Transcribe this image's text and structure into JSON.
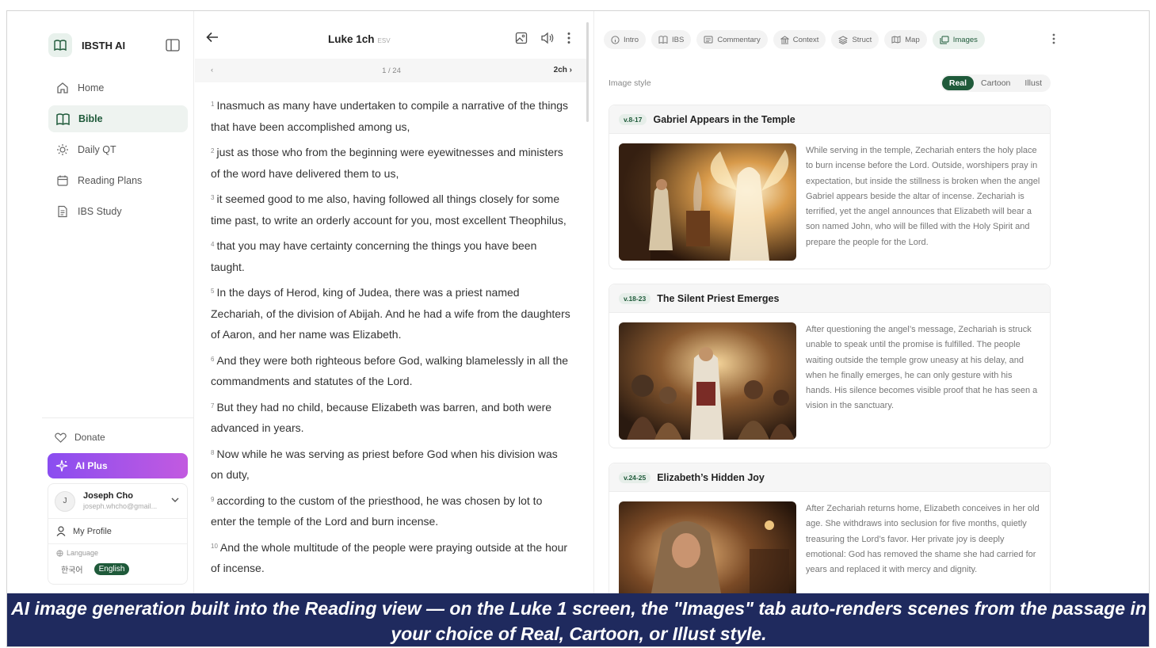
{
  "brand": {
    "name": "IBSTH AI"
  },
  "sidebar": {
    "items": [
      {
        "label": "Home",
        "icon": "home-icon"
      },
      {
        "label": "Bible",
        "icon": "book-icon",
        "active": true
      },
      {
        "label": "Daily QT",
        "icon": "sun-icon"
      },
      {
        "label": "Reading Plans",
        "icon": "calendar-icon"
      },
      {
        "label": "IBS Study",
        "icon": "document-icon"
      }
    ],
    "donate": "Donate",
    "ai_plus": "AI Plus",
    "user": {
      "initial": "J",
      "name": "Joseph Cho",
      "email": "joseph.whcho@gmail..."
    },
    "my_profile": "My Profile",
    "language_label": "Language",
    "languages": [
      "한국어",
      "English"
    ],
    "selected_language": "English"
  },
  "reader": {
    "title": "Luke 1ch",
    "version": "ESV",
    "pager": {
      "prev": "‹",
      "count": "1 / 24",
      "next": "2ch ›"
    },
    "verses": [
      {
        "n": "1",
        "text": "Inasmuch as many have undertaken to compile a narrative of the things that have been accomplished among us,"
      },
      {
        "n": "2",
        "text": "just as those who from the beginning were eyewitnesses and ministers of the word have delivered them to us,"
      },
      {
        "n": "3",
        "text": "it seemed good to me also, having followed all things closely for some time past, to write an orderly account for you, most excellent Theophilus,"
      },
      {
        "n": "4",
        "text": "that you may have certainty concerning the things you have been taught."
      },
      {
        "n": "5",
        "text": "In the days of Herod, king of Judea, there was a priest named Zechariah, of the division of Abijah. And he had a wife from the daughters of Aaron, and her name was Elizabeth."
      },
      {
        "n": "6",
        "text": "And they were both righteous before God, walking blamelessly in all the commandments and statutes of the Lord."
      },
      {
        "n": "7",
        "text": "But they had no child, because Elizabeth was barren, and both were advanced in years."
      },
      {
        "n": "8",
        "text": "Now while he was serving as priest before God when his division was on duty,"
      },
      {
        "n": "9",
        "text": "according to the custom of the priesthood, he was chosen by lot to enter the temple of the Lord and burn incense."
      },
      {
        "n": "10",
        "text": "And the whole multitude of the people were praying outside at the hour of incense."
      }
    ]
  },
  "panel": {
    "tabs": [
      {
        "label": "Intro",
        "icon": "info-icon"
      },
      {
        "label": "IBS",
        "icon": "book-icon"
      },
      {
        "label": "Commentary",
        "icon": "comment-icon"
      },
      {
        "label": "Context",
        "icon": "building-icon"
      },
      {
        "label": "Struct",
        "icon": "layers-icon"
      },
      {
        "label": "Map",
        "icon": "map-icon"
      },
      {
        "label": "Images",
        "icon": "images-icon",
        "active": true
      }
    ],
    "image_style_label": "Image style",
    "styles": [
      "Real",
      "Cartoon",
      "Illust"
    ],
    "selected_style": "Real",
    "cards": [
      {
        "range": "v.8-17",
        "title": "Gabriel Appears in the Temple",
        "text": "While serving in the temple, Zechariah enters the holy place to burn incense before the Lord. Outside, worshipers pray in expectation, but inside the stillness is broken when the angel Gabriel appears beside the altar of incense. Zechariah is terrified, yet the angel announces that Elizabeth will bear a son named John, who will be filled with the Holy Spirit and prepare the people for the Lord."
      },
      {
        "range": "v.18-23",
        "title": "The Silent Priest Emerges",
        "text": "After questioning the angel’s message, Zechariah is struck unable to speak until the promise is fulfilled. The people waiting outside the temple grow uneasy at his delay, and when he finally emerges, he can only gesture with his hands. His silence becomes visible proof that he has seen a vision in the sanctuary."
      },
      {
        "range": "v.24-25",
        "title": "Elizabeth’s Hidden Joy",
        "text": "After Zechariah returns home, Elizabeth conceives in her old age. She withdraws into seclusion for five months, quietly treasuring the Lord’s favor. Her private joy is deeply emotional: God has removed the shame she had carried for years and replaced it with mercy and dignity."
      }
    ]
  },
  "caption": "AI image generation built into the Reading view — on the Luke 1 screen, the \"Images\" tab auto-renders scenes from the passage in your choice of Real, Cartoon, or Illust style.",
  "colors": {
    "accent": "#1f5a3a",
    "ai_plus_start": "#8a4df0",
    "ai_plus_end": "#c25ae0",
    "caption_bg": "#1f2a5e"
  }
}
